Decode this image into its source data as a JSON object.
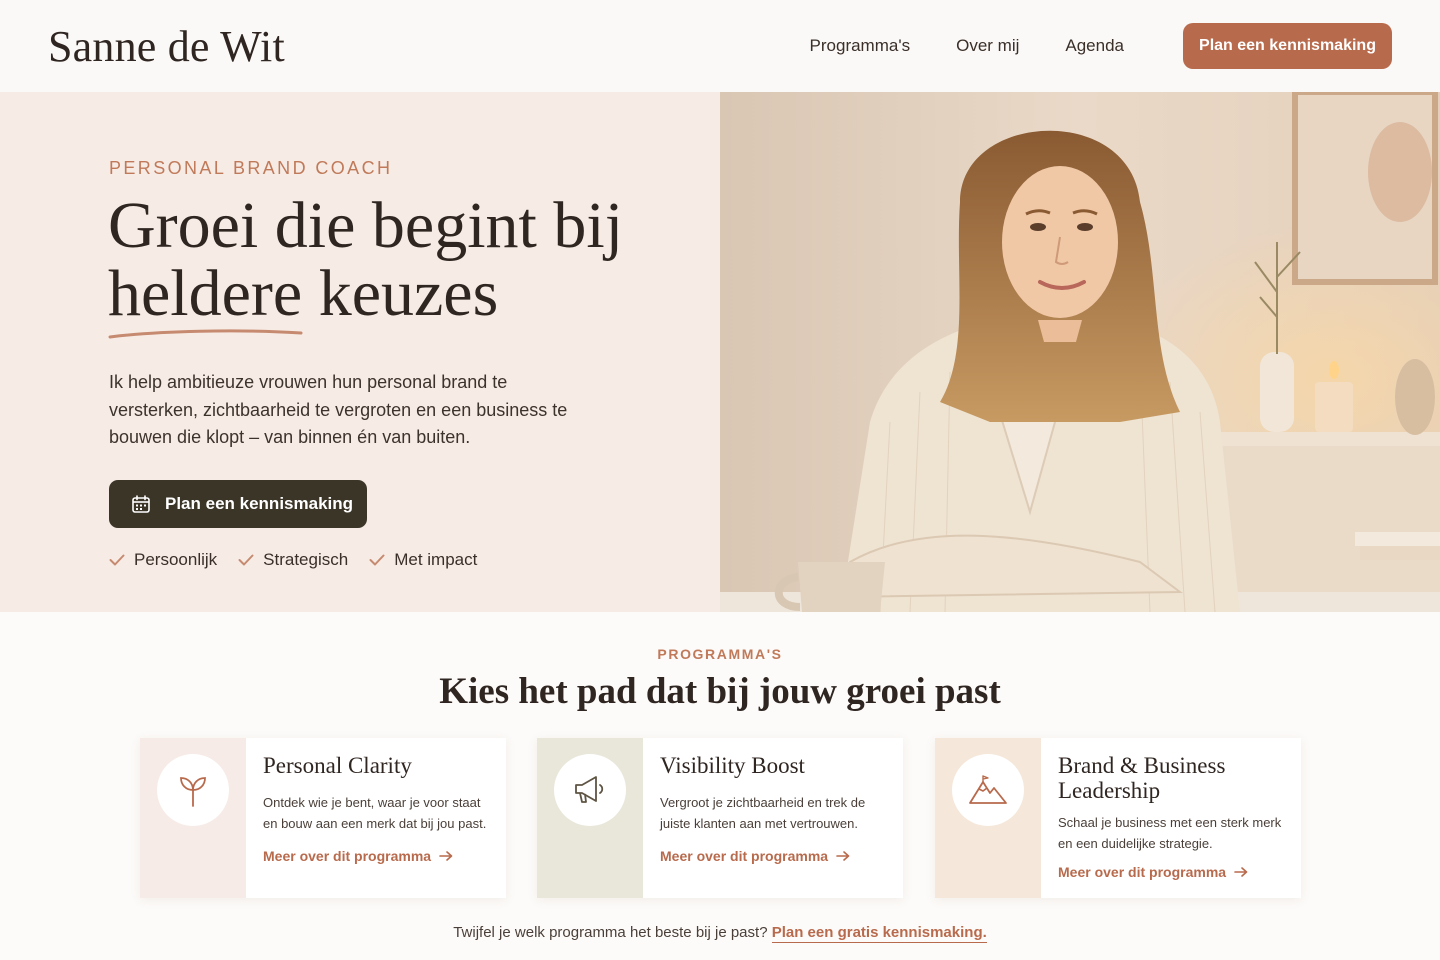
{
  "header": {
    "logo": "Sanne de Wit",
    "nav": [
      "Programma's",
      "Over mij",
      "Agenda"
    ],
    "cta": "Plan een kennismaking"
  },
  "hero": {
    "eyebrow": "PERSONAL BRAND COACH",
    "title_line1": "Groei die begint bij",
    "title_line2": "heldere keuzes",
    "text": "Ik help ambitieuze vrouwen hun personal brand te versterken, zichtbaarheid te vergroten en een business te bouwen die klopt – van binnen én van buiten.",
    "cta": "Plan een kennismaking",
    "checks": [
      "Persoonlijk",
      "Strategisch",
      "Met impact"
    ]
  },
  "programs": {
    "eyebrow": "PROGRAMMA'S",
    "title": "Kies het pad dat bij jouw groei past",
    "cards": [
      {
        "title": "Personal Clarity",
        "desc": "Ontdek wie je bent, waar je voor staat en bouw aan een merk dat bij jou past.",
        "link": "Meer over dit programma",
        "icon": "sprout-icon",
        "side_color": "#f6ebe6"
      },
      {
        "title": "Visibility Boost",
        "desc": "Vergroot je zichtbaarheid en trek de juiste klanten aan met vertrouwen.",
        "link": "Meer over dit programma",
        "icon": "megaphone-icon",
        "side_color": "#e9e6da"
      },
      {
        "title": "Brand & Business Leadership",
        "desc": "Schaal je business met een sterk merk en een duidelijke strategie.",
        "link": "Meer over dit programma",
        "icon": "mountain-icon",
        "side_color": "#f5e7d9"
      }
    ],
    "footer_text": "Twijfel je welk programma het beste bij je past?",
    "footer_link": "Plan een gratis kennismaking."
  },
  "colors": {
    "accent": "#b86a4c",
    "dark_button": "#3b3528",
    "hero_bg": "#f7ece5"
  }
}
